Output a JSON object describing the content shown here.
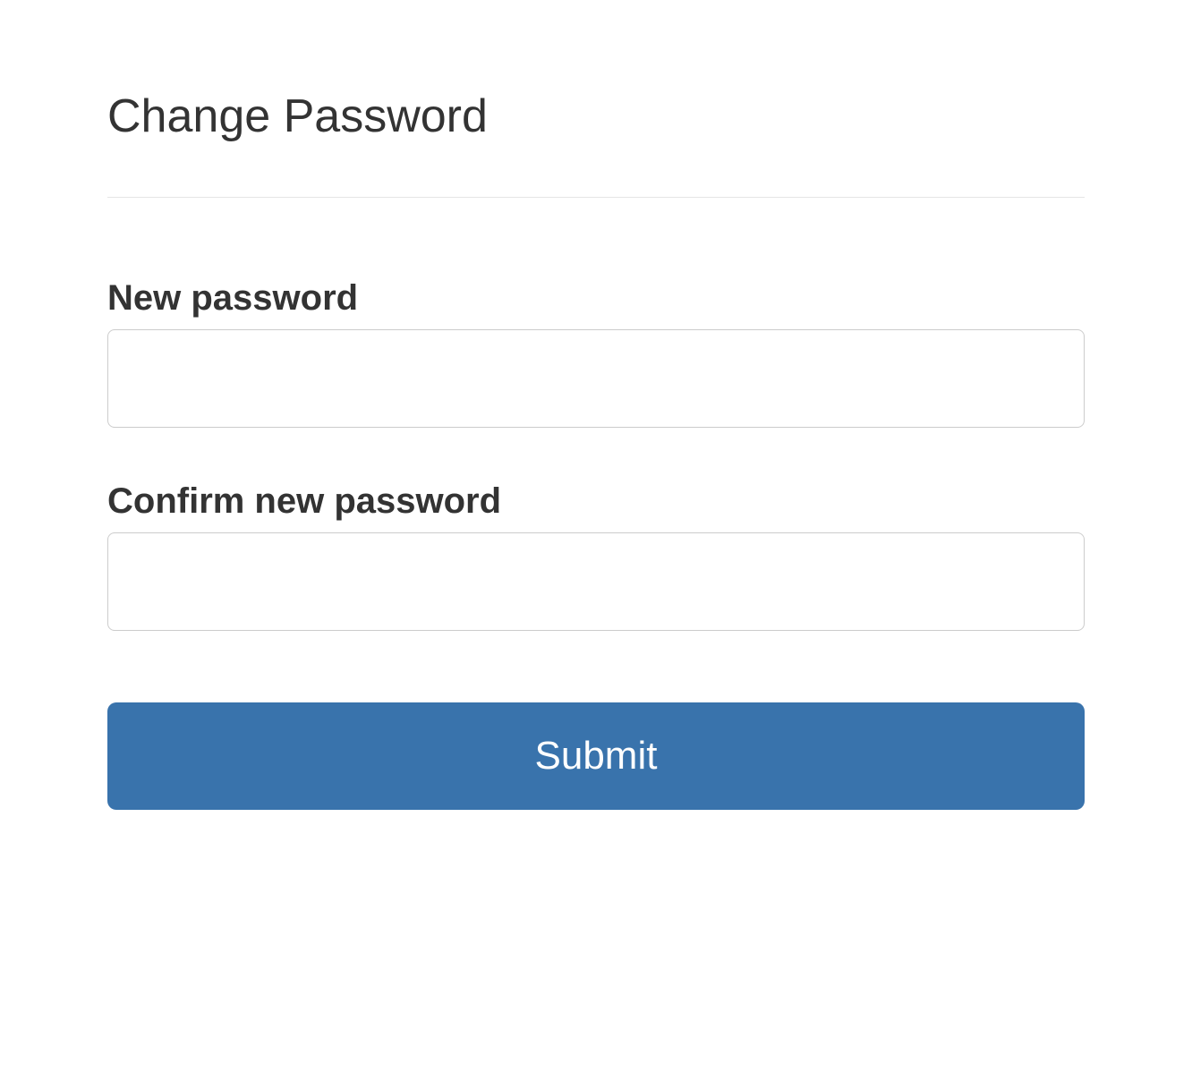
{
  "page": {
    "title": "Change Password"
  },
  "form": {
    "fields": {
      "new_password": {
        "label": "New password",
        "value": ""
      },
      "confirm_password": {
        "label": "Confirm new password",
        "value": ""
      }
    },
    "submit_label": "Submit"
  },
  "colors": {
    "primary_button": "#3973ac",
    "text": "#333333",
    "border": "#cccccc",
    "divider": "#e5e5e5"
  }
}
